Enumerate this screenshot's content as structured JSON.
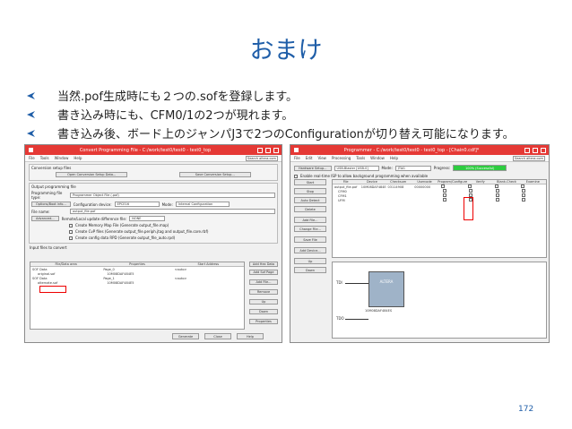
{
  "slide": {
    "title": "おまけ",
    "bullets": [
      "当然.pof生成時にも２つの.sofを登録します。",
      "書き込み時にも、CFM0/1の2つが現れます。",
      "書き込み後、ボード上のジャンパJ3で2つのConfigurationが切り替え可能になります。"
    ],
    "page_number": "172",
    "bullet_color": "#1f5ea8"
  },
  "left_window": {
    "title": "Convert Programming File - C:/work/test0/test0 - test0_top",
    "menu": [
      "File",
      "Tools",
      "Window",
      "Help"
    ],
    "search_placeholder": "Search altera.com",
    "setup_group": "Conversion setup files",
    "open_setup_btn": "Open Conversion Setup Data...",
    "save_setup_btn": "Save Conversion Setup...",
    "output_group": "Output programming file",
    "prog_file_type_label": "Programming file type:",
    "prog_file_type_value": "Programmer Object File (.pof)",
    "options_btn": "Options/Boot info...",
    "config_device_label": "Configuration device:",
    "config_device_value": "EPCE16",
    "mode_label": "Mode:",
    "mode_value": "Internal Configuration",
    "file_name_label": "File name:",
    "file_name_value": "output_file.pof",
    "advanced_btn": "Advanced...",
    "remote_label": "Remote/Local update difference file:",
    "remote_value": "NONE",
    "chk1": "Create Memory Map File (Generate output_file.map)",
    "chk2": "Create CvP files (Generate output_file.periph.jtag and output_file.core.rbf)",
    "chk3": "Create config data RPD (Generate output_file_auto.rpd)",
    "input_group": "Input files to convert",
    "cols": [
      "File/Data area",
      "Properties",
      "Start Address"
    ],
    "rows": [
      [
        "SOF Data",
        "Page_0",
        "<auto>"
      ],
      [
        "original.sof",
        "10M08DAF484E5",
        ""
      ],
      [
        "SOF Data",
        "Page_1",
        "<auto>"
      ],
      [
        "alternate.sof",
        "10M08DAF484E5",
        ""
      ]
    ],
    "side_buttons": [
      "Add Hex Data",
      "Add Sof Page",
      "Add File...",
      "Remove",
      "Up",
      "Down",
      "Properties"
    ],
    "bottom_buttons": [
      "Generate",
      "Close",
      "Help"
    ]
  },
  "right_window": {
    "title": "Programmer - C:/work/test0/test0 - test0_top - [Chain0.cdf]*",
    "menu": [
      "File",
      "Edit",
      "View",
      "Processing",
      "Tools",
      "Window",
      "Help"
    ],
    "search_placeholder": "Search altera.com",
    "hw_setup_btn": "Hardware Setup...",
    "hw_value": "USB-Blaster [USB-0]",
    "mode_label": "Mode:",
    "mode_value": "JTAG",
    "progress_label": "Progress:",
    "progress_value": "100% (Successful)",
    "progress_fraction": 1.0,
    "realtime_label": "Enable real-time ISP to allow background programming when available",
    "side_buttons": [
      "Start",
      "Stop",
      "Auto Detect",
      "Delete",
      "Add File...",
      "Change File...",
      "Save File",
      "Add Device...",
      "Up",
      "Down"
    ],
    "cols": [
      "File",
      "Device",
      "Checksum",
      "Usercode",
      "Program/Configure",
      "Verify",
      "Blank-Check",
      "Examine"
    ],
    "rows": [
      [
        "output_file.pof",
        "10M08DAF484ES",
        "03114908",
        "00000000"
      ],
      [
        "CFM0",
        "",
        "",
        ""
      ],
      [
        "CFM1",
        "",
        "",
        ""
      ],
      [
        "UFM",
        "",
        "",
        ""
      ]
    ],
    "tdi_label": "TDI",
    "tdo_label": "TDO",
    "chip_label": "ALTERA",
    "chip_part": "10M08DAF484ES"
  }
}
